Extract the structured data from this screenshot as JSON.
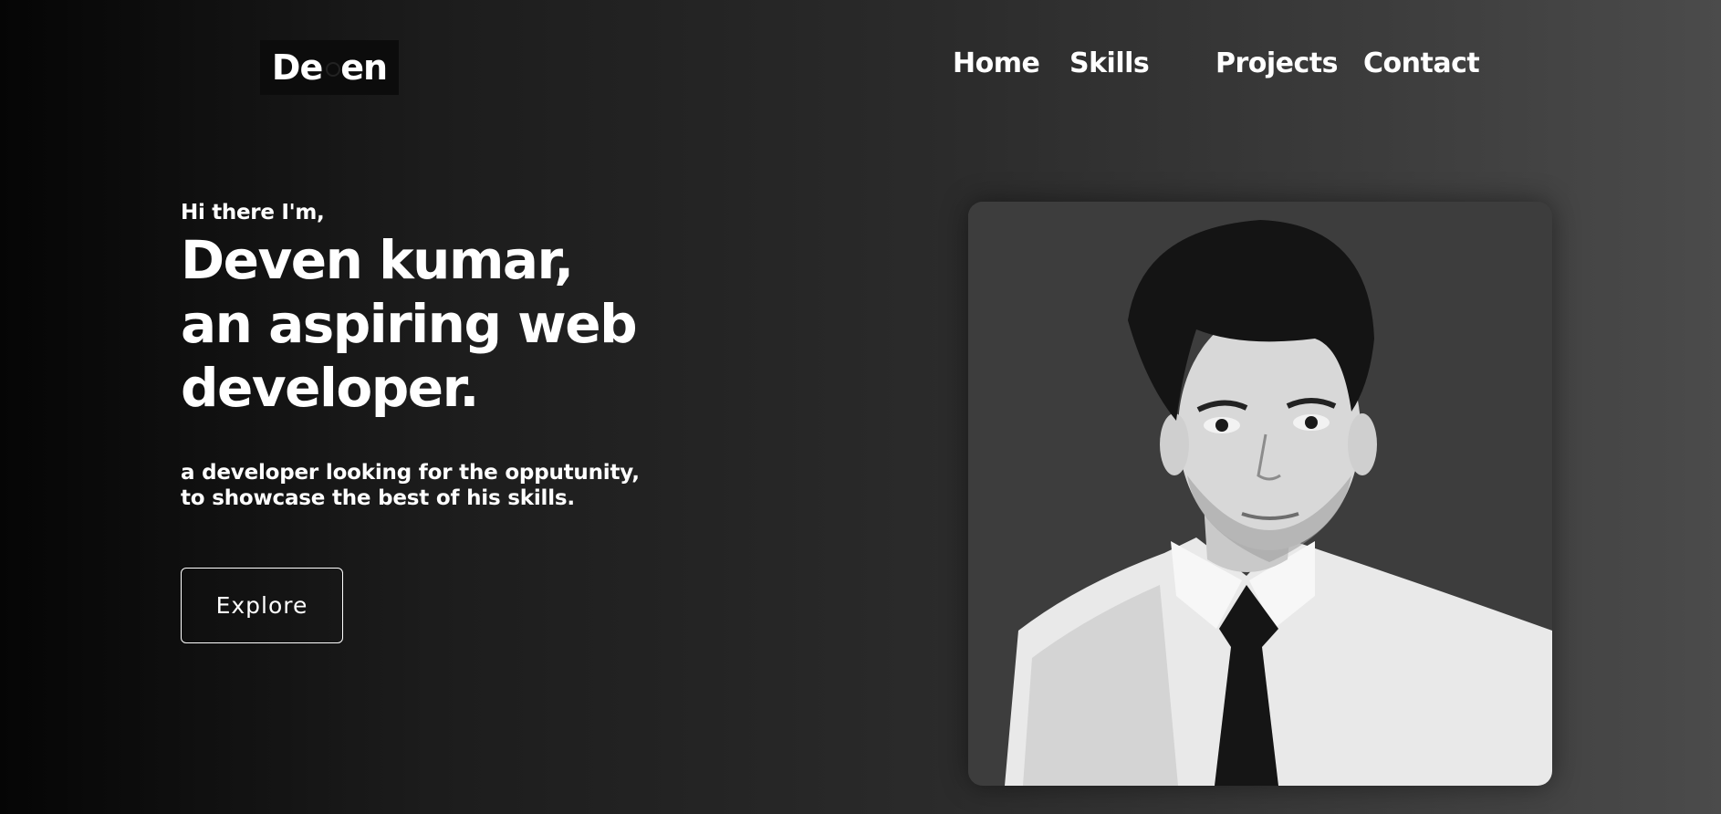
{
  "header": {
    "logo_prefix": "De",
    "logo_suffix": "en"
  },
  "nav": {
    "items": [
      {
        "label": "Home"
      },
      {
        "label": "Skills"
      },
      {
        "label": "Projects"
      },
      {
        "label": "Contact"
      }
    ]
  },
  "hero": {
    "greeting": "Hi there I'm,",
    "headline_line1": "Deven kumar,",
    "headline_line2": "an aspiring web",
    "headline_line3": "developer.",
    "tagline_line1": "a developer looking for the opputunity,",
    "tagline_line2": "to showcase the best of his skills.",
    "cta_label": "Explore"
  },
  "colors": {
    "background_start": "#050505",
    "background_end": "#4b4b4b",
    "text": "#ffffff",
    "photo_backdrop": "#3c3c3c"
  }
}
